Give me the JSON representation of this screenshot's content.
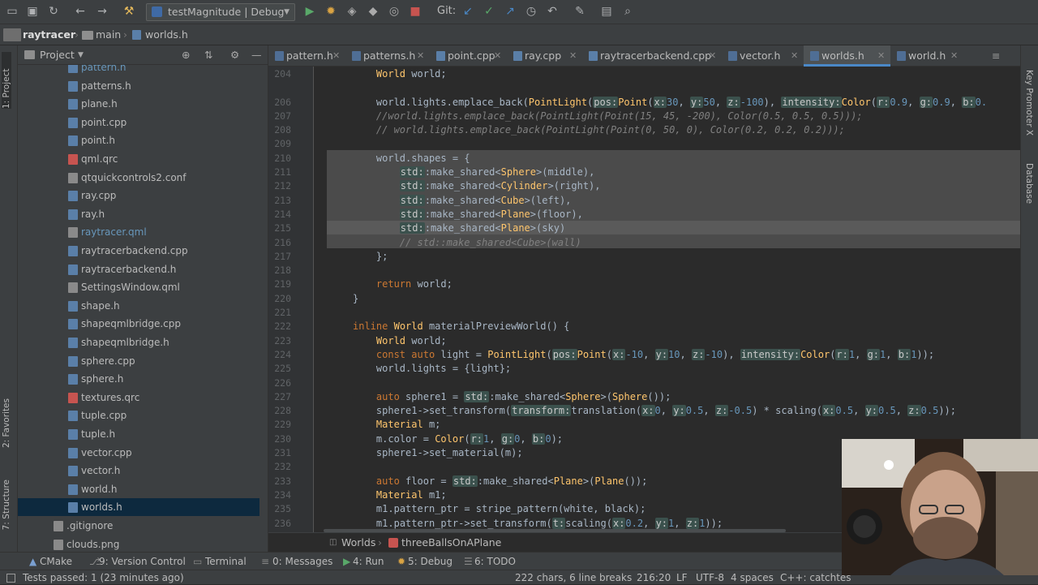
{
  "toolbar": {
    "config_label": "testMagnitude | Debug",
    "git_label": "Git:"
  },
  "navbar": {
    "crumbs": [
      "raytracer",
      "main",
      "worlds.h"
    ]
  },
  "project_panel": {
    "title": "Project",
    "files": [
      {
        "name": "pattern.h",
        "kind": "h",
        "muted": true
      },
      {
        "name": "patterns.h",
        "kind": "h"
      },
      {
        "name": "plane.h",
        "kind": "h"
      },
      {
        "name": "point.cpp",
        "kind": "cpp"
      },
      {
        "name": "point.h",
        "kind": "h"
      },
      {
        "name": "qml.qrc",
        "kind": "qrc"
      },
      {
        "name": "qtquickcontrols2.conf",
        "kind": "conf"
      },
      {
        "name": "ray.cpp",
        "kind": "cpp"
      },
      {
        "name": "ray.h",
        "kind": "h"
      },
      {
        "name": "raytracer.qml",
        "kind": "qml",
        "muted": true
      },
      {
        "name": "raytracerbackend.cpp",
        "kind": "cpp"
      },
      {
        "name": "raytracerbackend.h",
        "kind": "h"
      },
      {
        "name": "SettingsWindow.qml",
        "kind": "qml"
      },
      {
        "name": "shape.h",
        "kind": "h"
      },
      {
        "name": "shapeqmlbridge.cpp",
        "kind": "cpp"
      },
      {
        "name": "shapeqmlbridge.h",
        "kind": "h"
      },
      {
        "name": "sphere.cpp",
        "kind": "cpp"
      },
      {
        "name": "sphere.h",
        "kind": "h"
      },
      {
        "name": "textures.qrc",
        "kind": "qrc"
      },
      {
        "name": "tuple.cpp",
        "kind": "cpp"
      },
      {
        "name": "tuple.h",
        "kind": "h"
      },
      {
        "name": "vector.cpp",
        "kind": "cpp"
      },
      {
        "name": "vector.h",
        "kind": "h"
      },
      {
        "name": "world.h",
        "kind": "h"
      },
      {
        "name": "worlds.h",
        "kind": "h",
        "selected": true
      },
      {
        "name": ".gitignore",
        "kind": "git"
      },
      {
        "name": "clouds.png",
        "kind": "png"
      }
    ]
  },
  "left_strip": {
    "project": "1: Project",
    "favorites": "2: Favorites",
    "structure": "7: Structure"
  },
  "right_strip": {
    "key_promoter": "Key Promoter X",
    "database": "Database"
  },
  "tabs": [
    {
      "label": "pattern.h"
    },
    {
      "label": "patterns.h"
    },
    {
      "label": "point.cpp"
    },
    {
      "label": "ray.cpp"
    },
    {
      "label": "raytracerbackend.cpp"
    },
    {
      "label": "vector.h"
    },
    {
      "label": "worlds.h",
      "active": true
    },
    {
      "label": "world.h"
    }
  ],
  "editor": {
    "line_numbers": [
      "204",
      "206",
      "207",
      "208",
      "209",
      "210",
      "211",
      "212",
      "213",
      "214",
      "215",
      "216",
      "217",
      "218",
      "219",
      "220",
      "221",
      "222",
      "223",
      "224",
      "225",
      "226",
      "227",
      "228",
      "229",
      "230",
      "231",
      "232",
      "233",
      "234",
      "235",
      "236"
    ],
    "lines": [
      "    World world;",
      "    world.lights.emplace_back(PointLight(pos:Point(x:30, y:50, z:-100), intensity:Color(r:0.9, g:0.9, b:0.",
      "    //world.lights.emplace_back(PointLight(Point(15, 45, -200), Color(0.5, 0.5, 0.5)));",
      "    // world.lights.emplace_back(PointLight(Point(0, 50, 0), Color(0.2, 0.2, 0.2)));",
      "",
      "    world.shapes = {",
      "        std::make_shared<Sphere>(middle),",
      "        std::make_shared<Cylinder>(right),",
      "        std::make_shared<Cube>(left),",
      "        std::make_shared<Plane>(floor),",
      "        std::make_shared<Plane>(sky)",
      "        // std::make_shared<Cube>(wall)",
      "    };",
      "",
      "    return world;",
      "}",
      "",
      "inline World materialPreviewWorld() {",
      "    World world;",
      "    const auto light = PointLight(pos:Point(x:-10, y:10, z:-10), intensity:Color(r:1, g:1, b:1));",
      "    world.lights = {light};",
      "",
      "    auto sphere1 = std::make_shared<Sphere>(Sphere());",
      "    sphere1->set_transform(transform:translation(x:0, y:0.5, z:-0.5) * scaling(x:0.5, y:0.5, z:0.5));",
      "    Material m;",
      "    m.color = Color(r:1, g:0, b:0);",
      "    sphere1->set_material(m);",
      "",
      "    auto floor = std::make_shared<Plane>(Plane());",
      "    Material m1;",
      "    m1.pattern_ptr = stripe_pattern(white, black);",
      "    m1.pattern_ptr->set_transform(t:scaling(x:0.2, y:1, z:1));"
    ]
  },
  "editor_breadcrumb": {
    "scope": "Worlds",
    "function": "threeBallsOnAPlane"
  },
  "bottom_tools": {
    "cmake": "CMake",
    "vcs": "9: Version Control",
    "terminal": "Terminal",
    "messages": "0: Messages",
    "run": "4: Run",
    "debug": "5: Debug",
    "todo": "6: TODO"
  },
  "status": {
    "tests": "Tests passed: 1 (23 minutes ago)",
    "selection": "222 chars, 6 line breaks",
    "position": "216:20",
    "line_ending": "LF",
    "encoding": "UTF-8",
    "indent": "4 spaces",
    "context": "C++: catchtes"
  },
  "colors": {
    "accent": "#4a88c7",
    "keyword": "#cc7832",
    "function": "#ffc66d",
    "number": "#6897bb"
  }
}
